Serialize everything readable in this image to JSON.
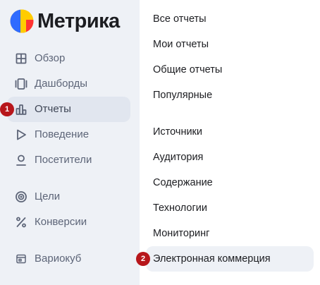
{
  "app": {
    "title": "Метрика"
  },
  "sidebar": {
    "items": [
      {
        "label": "Обзор",
        "icon": "grid-icon"
      },
      {
        "label": "Дашборды",
        "icon": "dashboards-icon"
      },
      {
        "label": "Отчеты",
        "icon": "bar-chart-icon",
        "active": true,
        "badge": "1"
      },
      {
        "label": "Поведение",
        "icon": "play-icon"
      },
      {
        "label": "Посетители",
        "icon": "user-icon"
      },
      {
        "label": "Цели",
        "icon": "target-icon"
      },
      {
        "label": "Конверсии",
        "icon": "percent-icon"
      },
      {
        "label": "Вариокуб",
        "icon": "cube-icon"
      }
    ]
  },
  "reports_menu": {
    "group1": [
      "Все отчеты",
      "Мои отчеты",
      "Общие отчеты",
      "Популярные"
    ],
    "group2": [
      "Источники",
      "Аудитория",
      "Содержание",
      "Технологии",
      "Мониторинг",
      "Электронная коммерция"
    ],
    "hover_badge": "2"
  },
  "colors": {
    "badge": "#b7161b",
    "sidebar_bg": "#eef1f6",
    "active_bg": "#e1e6ef",
    "logo_blue": "#2f6bff",
    "logo_yellow": "#ffcc00",
    "logo_red": "#ff3333"
  }
}
